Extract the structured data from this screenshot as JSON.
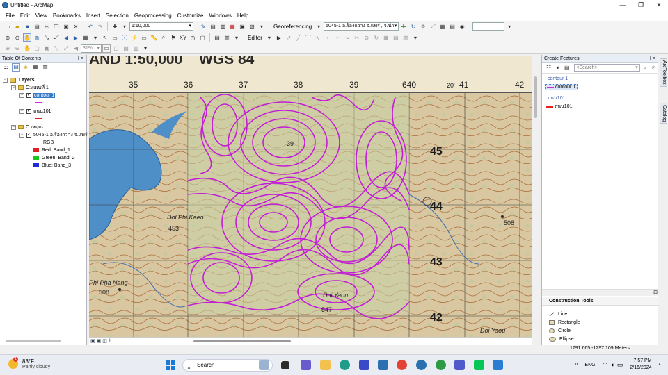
{
  "window": {
    "title": "Untitled - ArcMap",
    "controls": [
      "—",
      "❐",
      "✕"
    ]
  },
  "menu": [
    "File",
    "Edit",
    "View",
    "Bookmarks",
    "Insert",
    "Selection",
    "Geoprocessing",
    "Customize",
    "Windows",
    "Help"
  ],
  "toolbar": {
    "scale_value": "1:10,000",
    "georef_label": "Georeferencing",
    "georef_layer": "5045-1 อ.ร้องกวาง  จ.แพร่ , จ.น่าน",
    "editor_label": "Editor",
    "zoom_percent": "31%"
  },
  "toc": {
    "title": "Table Of Contents",
    "root_label": "Layers",
    "group1_path": "C:\\แผนที่ 1",
    "layer_contour": "contour 1",
    "layer_road": "ถนน101",
    "group2_path": "C:\\หมุด\\",
    "raster_name": "5045-1 อ.ร้องกวาง  จ.แพร่",
    "raster_type": "RGB",
    "band_red": "Red:   Band_1",
    "band_green": "Green: Band_2",
    "band_blue": "Blue:  Band_3",
    "colors": {
      "contour": "#d02bd9",
      "road": "#e02020",
      "red": "#e02020",
      "green": "#1fc21f",
      "blue": "#1a2fd8"
    }
  },
  "map": {
    "header_text": "AND 1:50,000",
    "datum_text": "WGS 84",
    "col_labels": [
      "35",
      "36",
      "37",
      "38",
      "39",
      "640",
      "41",
      "42"
    ],
    "minute_mark": "20'",
    "row_labels": [
      "45",
      "44",
      "43",
      "42"
    ],
    "spot_heights": [
      "453",
      "508",
      "508",
      "547",
      "39"
    ],
    "place_names": [
      "Doi Phi Kaeo",
      "Phi Pha Nang",
      "Doi Yaou",
      "Doi Yaou"
    ],
    "contour_color": "#c21ed6"
  },
  "create_features": {
    "title": "Create Features",
    "search_placeholder": "<Search>",
    "group_contour": "contour 1",
    "template_contour": "contour 1",
    "group_road": "ถนน101",
    "template_road": "ถนน101"
  },
  "construction_tools": {
    "title": "Construction Tools",
    "items": [
      "Line",
      "Rectangle",
      "Circle",
      "Ellipse"
    ]
  },
  "status": {
    "coordinates": "1791.665  -1297.109 Meters"
  },
  "side_tabs": [
    "ArcToolbox",
    "Catalog"
  ],
  "taskbar": {
    "temp": "83°F",
    "condition": "Partly cloudy",
    "alert_count": "1",
    "search_label": "Search",
    "lang": "ENG",
    "time": "7:57 PM",
    "date": "2/16/2024"
  }
}
